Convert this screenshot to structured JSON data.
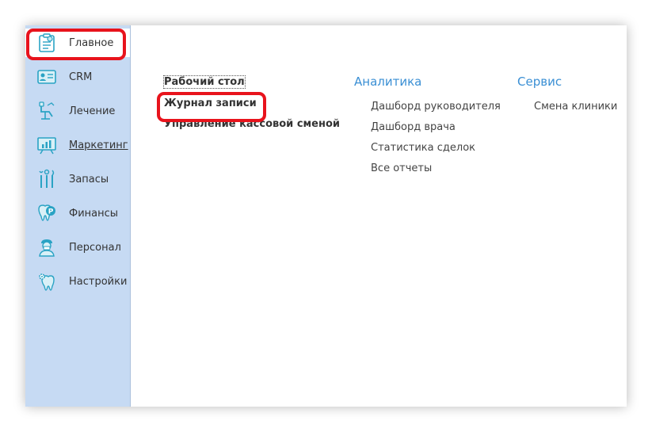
{
  "sidebar": {
    "items": [
      {
        "label": "Главное",
        "icon": "main-icon"
      },
      {
        "label": "CRM",
        "icon": "crm-card-icon"
      },
      {
        "label": "Лечение",
        "icon": "dental-chair-icon"
      },
      {
        "label": "Маркетинг",
        "icon": "marketing-board-icon"
      },
      {
        "label": "Запасы",
        "icon": "dental-tools-icon"
      },
      {
        "label": "Финансы",
        "icon": "tooth-coin-icon"
      },
      {
        "label": "Персонал",
        "icon": "doctor-icon"
      },
      {
        "label": "Настройки",
        "icon": "tooth-gear-icon"
      }
    ]
  },
  "main": {
    "links": [
      "Рабочий стол",
      "Журнал записи",
      "Управление кассовой сменой"
    ],
    "sections": [
      {
        "title": "Аналитика",
        "items": [
          "Дашборд руководителя",
          "Дашборд врача",
          "Статистика сделок",
          "Все отчеты"
        ]
      },
      {
        "title": "Сервис",
        "items": [
          "Смена клиники"
        ]
      }
    ]
  },
  "colors": {
    "sidebar_bg": "#c6daf3",
    "accent_blue": "#3a8fd4",
    "highlight_red": "#e8131c",
    "icon_teal": "#2aa3c4"
  }
}
